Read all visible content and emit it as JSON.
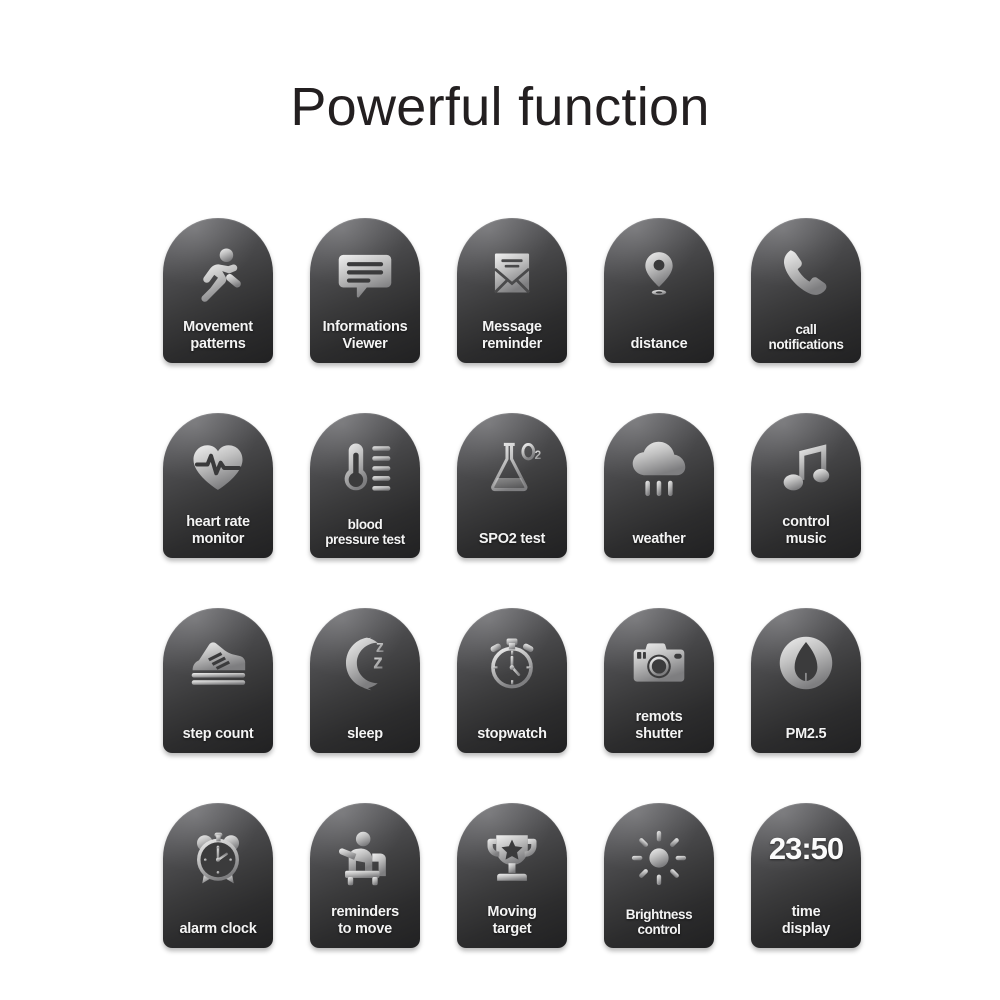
{
  "page": {
    "title": "Powerful function",
    "background_color": "#ffffff",
    "title_color": "#231f20",
    "tile_gradient_light": "#77777a",
    "tile_gradient_dark": "#212122",
    "label_color": "#f4f4f4",
    "icon_color": "#cfcfcf"
  },
  "grid": {
    "columns": 5,
    "rows": 4
  },
  "tiles": [
    {
      "id": "movement-patterns",
      "label": "Movement\npatterns",
      "icon": "running-person-icon",
      "size": "normal"
    },
    {
      "id": "informations-viewer",
      "label": "Informations\nViewer",
      "icon": "chat-bubble-lines-icon",
      "size": "normal"
    },
    {
      "id": "message-reminder",
      "label": "Message\nreminder",
      "icon": "envelope-icon",
      "size": "normal"
    },
    {
      "id": "distance",
      "label": "distance",
      "icon": "map-pin-icon",
      "size": "normal"
    },
    {
      "id": "call-notifications",
      "label": "call\nnotifications",
      "icon": "phone-handset-icon",
      "size": "small"
    },
    {
      "id": "heart-rate-monitor",
      "label": "heart rate\nmonitor",
      "icon": "heart-pulse-icon",
      "size": "normal"
    },
    {
      "id": "blood-pressure-test",
      "label": "blood\npressure test",
      "icon": "thermometer-scale-icon",
      "size": "small"
    },
    {
      "id": "spo2-test",
      "label": "SPO2 test",
      "icon": "flask-o2-icon",
      "size": "normal"
    },
    {
      "id": "weather",
      "label": "weather",
      "icon": "rain-cloud-icon",
      "size": "normal"
    },
    {
      "id": "control-music",
      "label": "control\nmusic",
      "icon": "music-note-icon",
      "size": "normal"
    },
    {
      "id": "step-count",
      "label": "step count",
      "icon": "sneaker-icon",
      "size": "normal"
    },
    {
      "id": "sleep",
      "label": "sleep",
      "icon": "moon-zzz-icon",
      "size": "normal"
    },
    {
      "id": "stopwatch",
      "label": "stopwatch",
      "icon": "stopwatch-icon",
      "size": "normal"
    },
    {
      "id": "remots-shutter",
      "label": "remots\nshutter",
      "icon": "camera-icon",
      "size": "normal"
    },
    {
      "id": "pm25",
      "label": "PM2.5",
      "icon": "leaf-circle-icon",
      "size": "normal"
    },
    {
      "id": "alarm-clock",
      "label": "alarm clock",
      "icon": "alarm-clock-icon",
      "size": "normal"
    },
    {
      "id": "reminders-to-move",
      "label": "reminders\nto move",
      "icon": "sitting-person-icon",
      "size": "normal"
    },
    {
      "id": "moving-target",
      "label": "Moving\ntarget",
      "icon": "trophy-star-icon",
      "size": "normal"
    },
    {
      "id": "brightness-control",
      "label": "Brightness\ncontrol",
      "icon": "sun-brightness-icon",
      "size": "small"
    },
    {
      "id": "time-display",
      "label": "time\ndisplay",
      "icon": "digital-time-readout",
      "size": "normal",
      "readout": "23:50"
    }
  ]
}
